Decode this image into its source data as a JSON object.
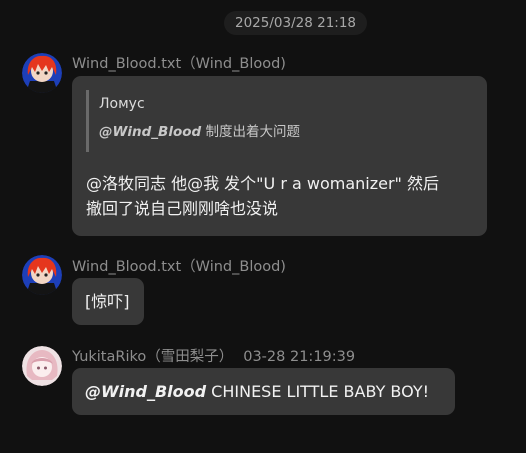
{
  "divider": {
    "timestamp": "2025/03/28 21:18"
  },
  "messages": [
    {
      "sender": "Wind_Blood.txt（Wind_Blood)",
      "quote": {
        "author": "Ломус",
        "mention": "@Wind_Blood",
        "text": " 制度出着大问题"
      },
      "lines": [
        "@洛牧同志 他@我 发个\"U r a womanizer\" 然后",
        "撤回了说自己刚刚啥也没说"
      ]
    },
    {
      "sender": "Wind_Blood.txt（Wind_Blood)",
      "text": "[惊吓]"
    },
    {
      "sender": "YukitaRiko（雪田梨子）",
      "timestamp": "03-28 21:19:39",
      "mention": "@Wind_Blood",
      "text": " CHINESE LITTLE BABY BOY!"
    }
  ],
  "colors": {
    "background": "#111111",
    "bubble": "#383838",
    "quote_bar": "#6a6a6a",
    "sender_text": "#8e8e8e"
  },
  "icons": {
    "avatar1": "anime-avatar-red-hair",
    "avatar2": "anime-avatar-red-hair",
    "avatar3": "anime-avatar-pink-hair"
  }
}
